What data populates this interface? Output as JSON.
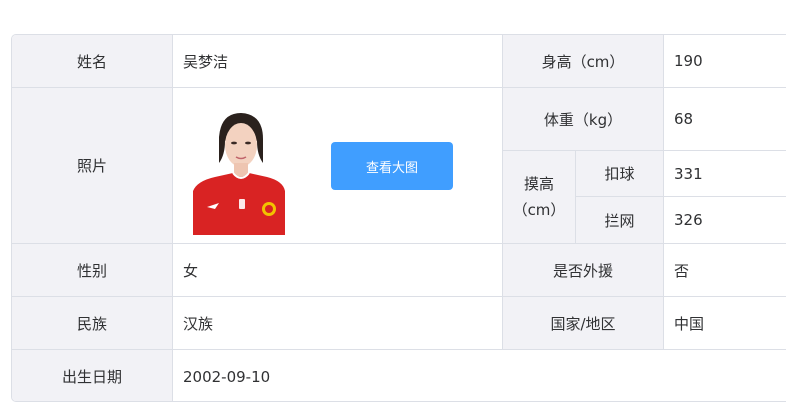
{
  "table": {
    "name_label": "姓名",
    "name_value": "吴梦洁",
    "height_label": "身高（cm）",
    "height_value": "190",
    "photo_label": "照片",
    "view_button": "查看大图",
    "weight_label": "体重（kg）",
    "weight_value": "68",
    "reach_label_line1": "摸高",
    "reach_label_line2": "（cm）",
    "spike_label": "扣球",
    "spike_value": "331",
    "block_label": "拦网",
    "block_value": "326",
    "gender_label": "性别",
    "gender_value": "女",
    "foreign_label": "是否外援",
    "foreign_value": "否",
    "ethnicity_label": "民族",
    "ethnicity_value": "汉族",
    "country_label": "国家/地区",
    "country_value": "中国",
    "birth_label": "出生日期",
    "birth_value": "2002-09-10"
  },
  "colors": {
    "label_bg": "#f2f2f6",
    "border": "#dcdfe6",
    "button": "#409eff",
    "jersey": "#d92323"
  }
}
